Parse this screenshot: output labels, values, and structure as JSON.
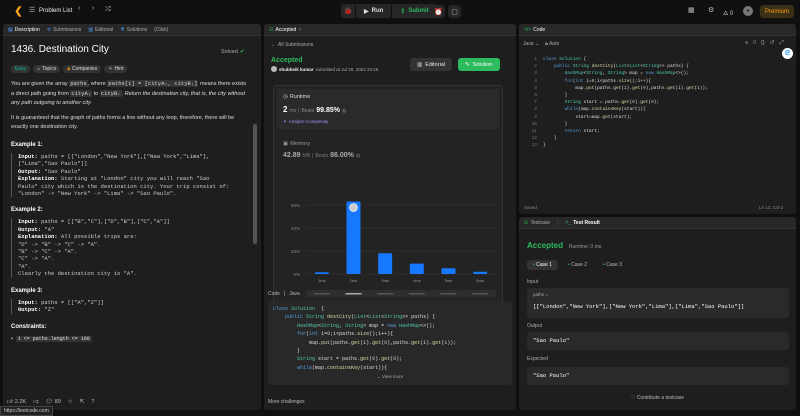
{
  "topbar": {
    "list_label": "Problem List",
    "run": "Run",
    "submit": "Submit",
    "streak": "0",
    "premium": "Premium"
  },
  "left": {
    "tabs": [
      "Description",
      "Submissions",
      "Editorial",
      "Solutions",
      "(Click)"
    ],
    "title": "1436. Destination City",
    "solved": "Solved",
    "tags": {
      "difficulty": "Easy",
      "topics": "Topics",
      "companies": "Companies",
      "hint": "Hint"
    },
    "intro": {
      "a": "You are given the array ",
      "code1": "paths",
      "b": ", where ",
      "code2": "paths[i] = [cityAᵢ, cityBᵢ]",
      "c": " means there exists a direct path going from ",
      "code3": "cityAᵢ",
      "d": " to ",
      "code4": "cityBᵢ",
      "e": ". Return the destination city, that is, the city without any path outgoing to another city."
    },
    "guarantee": "It is guaranteed that the graph of paths forms a line without any loop, therefore, there will be exactly one destination city.",
    "examples": [
      {
        "h": "Example 1:",
        "lines": [
          [
            "Input:",
            " paths = [[\"London\",\"New York\"],[\"New York\",\"Lima\"],"
          ],
          [
            "",
            "[\"Lima\",\"Sao Paulo\"]]"
          ],
          [
            "Output:",
            " \"Sao Paulo\""
          ],
          [
            "Explanation:",
            " Starting at \"London\" city you will reach \"Sao"
          ],
          [
            "",
            "Paulo\" city which is the destination city. Your trip consist of:"
          ],
          [
            "",
            "\"London\" -> \"New York\" -> \"Lima\" -> \"Sao Paulo\"."
          ]
        ]
      },
      {
        "h": "Example 2:",
        "lines": [
          [
            "Input:",
            " paths = [[\"B\",\"C\"],[\"D\",\"B\"],[\"C\",\"A\"]]"
          ],
          [
            "Output:",
            " \"A\""
          ],
          [
            "Explanation:",
            " All possible trips are:"
          ],
          [
            "",
            "\"D\" -> \"B\" -> \"C\" -> \"A\"."
          ],
          [
            "",
            "\"B\" -> \"C\" -> \"A\"."
          ],
          [
            "",
            "\"C\" -> \"A\"."
          ],
          [
            "",
            "\"A\"."
          ],
          [
            "",
            "Clearly the destination city is \"A\"."
          ]
        ]
      },
      {
        "h": "Example 3:",
        "lines": [
          [
            "Input:",
            " paths = [[\"A\",\"Z\"]]"
          ],
          [
            "Output:",
            " \"Z\""
          ]
        ]
      }
    ],
    "constraints_h": "Constraints:",
    "constraint1": "1 <= paths.length <= 100",
    "footer": {
      "likes": "2.2K",
      "comments": "89"
    },
    "status_url": "https://leetcode.com"
  },
  "mid": {
    "tab": "Accepted",
    "back": "All Submissions",
    "status": "Accepted",
    "user": "shubbeik kumar",
    "submitted": "submitted at Jul 29, 2024 23:25",
    "editorial": "Editorial",
    "solution": "Solution",
    "runtime": {
      "label": "Runtime",
      "value": "2",
      "unit": "ms",
      "beats_label": "Beats",
      "beats": "99.85%",
      "analyze": "Analyze Complexity"
    },
    "memory": {
      "label": "Memory",
      "value": "42.89",
      "unit": "MB",
      "beats_label": "Beats",
      "beats": "86.00%"
    },
    "code_lang": {
      "code": "Code",
      "lang": "Java"
    },
    "code_lines": [
      [
        [
          "kw",
          "class "
        ],
        [
          "ty",
          "Solution"
        ],
        [
          "",
          "  {"
        ]
      ],
      [
        [
          "",
          "    "
        ],
        [
          "kw",
          "public "
        ],
        [
          "ty",
          "String "
        ],
        [
          "fn",
          "destCity"
        ],
        [
          "",
          "("
        ],
        [
          "ty",
          "List"
        ],
        [
          "",
          "<"
        ],
        [
          "ty",
          "List"
        ],
        [
          "",
          "<"
        ],
        [
          "ty",
          "String"
        ],
        [
          "",
          ">> paths) {"
        ]
      ],
      [
        [
          "",
          "        "
        ],
        [
          "ty",
          "HashMap"
        ],
        [
          "",
          "<"
        ],
        [
          "ty",
          "String"
        ],
        [
          "",
          ", "
        ],
        [
          "ty",
          "String"
        ],
        [
          "",
          "> map = "
        ],
        [
          "kw",
          "new "
        ],
        [
          "ty",
          "HashMap"
        ],
        [
          "",
          "<>();"
        ]
      ],
      [
        [
          "",
          "        "
        ],
        [
          "kw",
          "for"
        ],
        [
          "",
          "("
        ],
        [
          "kw",
          "int "
        ],
        [
          "",
          "i="
        ],
        [
          "nm",
          "0"
        ],
        [
          "",
          ";i<paths."
        ],
        [
          "fn",
          "size"
        ],
        [
          "",
          "();i++){"
        ]
      ],
      [
        [
          "",
          "            map."
        ],
        [
          "fn",
          "put"
        ],
        [
          "",
          "(paths."
        ],
        [
          "fn",
          "get"
        ],
        [
          "",
          "(i)."
        ],
        [
          "fn",
          "get"
        ],
        [
          "",
          "("
        ],
        [
          "nm",
          "0"
        ],
        [
          "",
          "),paths."
        ],
        [
          "fn",
          "get"
        ],
        [
          "",
          "(i)."
        ],
        [
          "fn",
          "get"
        ],
        [
          "",
          "("
        ],
        [
          "nm",
          "1"
        ],
        [
          "",
          "));"
        ]
      ],
      [
        [
          "",
          "        }"
        ]
      ],
      [
        [
          "",
          "        "
        ],
        [
          "ty",
          "String "
        ],
        [
          "",
          "start = paths."
        ],
        [
          "fn",
          "get"
        ],
        [
          "",
          "("
        ],
        [
          "nm",
          "0"
        ],
        [
          "",
          ")."
        ],
        [
          "fn",
          "get"
        ],
        [
          "",
          "("
        ],
        [
          "nm",
          "0"
        ],
        [
          "",
          ");"
        ]
      ],
      [
        [
          "",
          "        "
        ],
        [
          "kw",
          "while"
        ],
        [
          "",
          "(map."
        ],
        [
          "fn",
          "containsKey"
        ],
        [
          "",
          "(start)){"
        ]
      ]
    ],
    "view_more": "View more",
    "more": "More challenges"
  },
  "chart_data": {
    "type": "bar",
    "categories": [
      "1ms",
      "2ms",
      "3ms",
      "4ms",
      "5ms",
      "6ms"
    ],
    "values": [
      1.5,
      63,
      18,
      9,
      5,
      2
    ],
    "ylim": [
      0,
      80
    ],
    "yticks": [
      "60%",
      "40%",
      "20%",
      "0%"
    ],
    "ytick_vals": [
      60,
      40,
      20,
      0
    ],
    "highlight": "2ms",
    "colors": {
      "bar": "#1677ff"
    }
  },
  "right": {
    "code_tab": "Code",
    "lang": "Java",
    "auto": "Auto",
    "code": [
      [
        [
          "kw",
          "class "
        ],
        [
          "ty",
          "Solution "
        ],
        [
          "",
          "{"
        ]
      ],
      [
        [
          "",
          "    "
        ],
        [
          "kw",
          "public "
        ],
        [
          "ty",
          "String "
        ],
        [
          "fn",
          "destCity"
        ],
        [
          "",
          "("
        ],
        [
          "ty",
          "List"
        ],
        [
          "",
          "<"
        ],
        [
          "ty",
          "List"
        ],
        [
          "",
          "<"
        ],
        [
          "ty",
          "String"
        ],
        [
          "",
          ">> paths) {"
        ]
      ],
      [
        [
          "",
          "        "
        ],
        [
          "ty",
          "HashMap"
        ],
        [
          "",
          "<"
        ],
        [
          "ty",
          "String"
        ],
        [
          "",
          ", "
        ],
        [
          "ty",
          "String"
        ],
        [
          "",
          "> map = "
        ],
        [
          "kw",
          "new "
        ],
        [
          "ty",
          "HashMap"
        ],
        [
          "",
          "<>();"
        ]
      ],
      [
        [
          "",
          "        "
        ],
        [
          "kw",
          "for"
        ],
        [
          "",
          "("
        ],
        [
          "kw",
          "int "
        ],
        [
          "",
          "i="
        ],
        [
          "nm",
          "0"
        ],
        [
          "",
          ";i<paths."
        ],
        [
          "fn",
          "size"
        ],
        [
          "",
          "();i++){"
        ]
      ],
      [
        [
          "",
          "            map."
        ],
        [
          "fn",
          "put"
        ],
        [
          "",
          "(paths."
        ],
        [
          "fn",
          "get"
        ],
        [
          "",
          "(i)."
        ],
        [
          "fn",
          "get"
        ],
        [
          "",
          "("
        ],
        [
          "nm",
          "0"
        ],
        [
          "",
          "),paths."
        ],
        [
          "fn",
          "get"
        ],
        [
          "",
          "(i)."
        ],
        [
          "fn",
          "get"
        ],
        [
          "",
          "("
        ],
        [
          "nm",
          "1"
        ],
        [
          "",
          "));"
        ]
      ],
      [
        [
          "",
          "        }"
        ]
      ],
      [
        [
          "",
          "        "
        ],
        [
          "ty",
          "String "
        ],
        [
          "",
          "start = paths."
        ],
        [
          "fn",
          "get"
        ],
        [
          "",
          "("
        ],
        [
          "nm",
          "0"
        ],
        [
          "",
          ")."
        ],
        [
          "fn",
          "get"
        ],
        [
          "",
          "("
        ],
        [
          "nm",
          "0"
        ],
        [
          "",
          ");"
        ]
      ],
      [
        [
          "",
          "        "
        ],
        [
          "kw",
          "while"
        ],
        [
          "",
          "(map."
        ],
        [
          "fn",
          "containsKey"
        ],
        [
          "",
          "(start)){"
        ]
      ],
      [
        [
          "",
          "            start=map."
        ],
        [
          "fn",
          "get"
        ],
        [
          "",
          "(start);"
        ]
      ],
      [
        [
          "",
          "        }"
        ]
      ],
      [
        [
          "",
          "        "
        ],
        [
          "kw",
          "return "
        ],
        [
          "",
          "start;"
        ]
      ],
      [
        [
          "",
          "    }"
        ]
      ],
      [
        [
          "",
          "}"
        ]
      ]
    ],
    "saved": "Saved",
    "cursor": "Ln 13, Col 2",
    "testcase_tab": "Testcase",
    "result_tab": "Test Result",
    "status": "Accepted",
    "runtime": "Runtime: 0 ms",
    "cases": [
      "Case 1",
      "Case 2",
      "Case 3"
    ],
    "input_label": "Input",
    "param": "paths =",
    "input_value": "[[\"London\",\"New York\"],[\"New York\",\"Lima\"],[\"Lima\",\"Sao Paulo\"]]",
    "output_label": "Output",
    "output_value": "\"Sao Paulo\"",
    "expected_label": "Expected",
    "expected_value": "\"Sao Paulo\"",
    "contribute": "Contribute a testcase"
  },
  "colors": {
    "accent": "#2cbb5d",
    "orange": "#ffa116",
    "bar": "#1677ff"
  }
}
